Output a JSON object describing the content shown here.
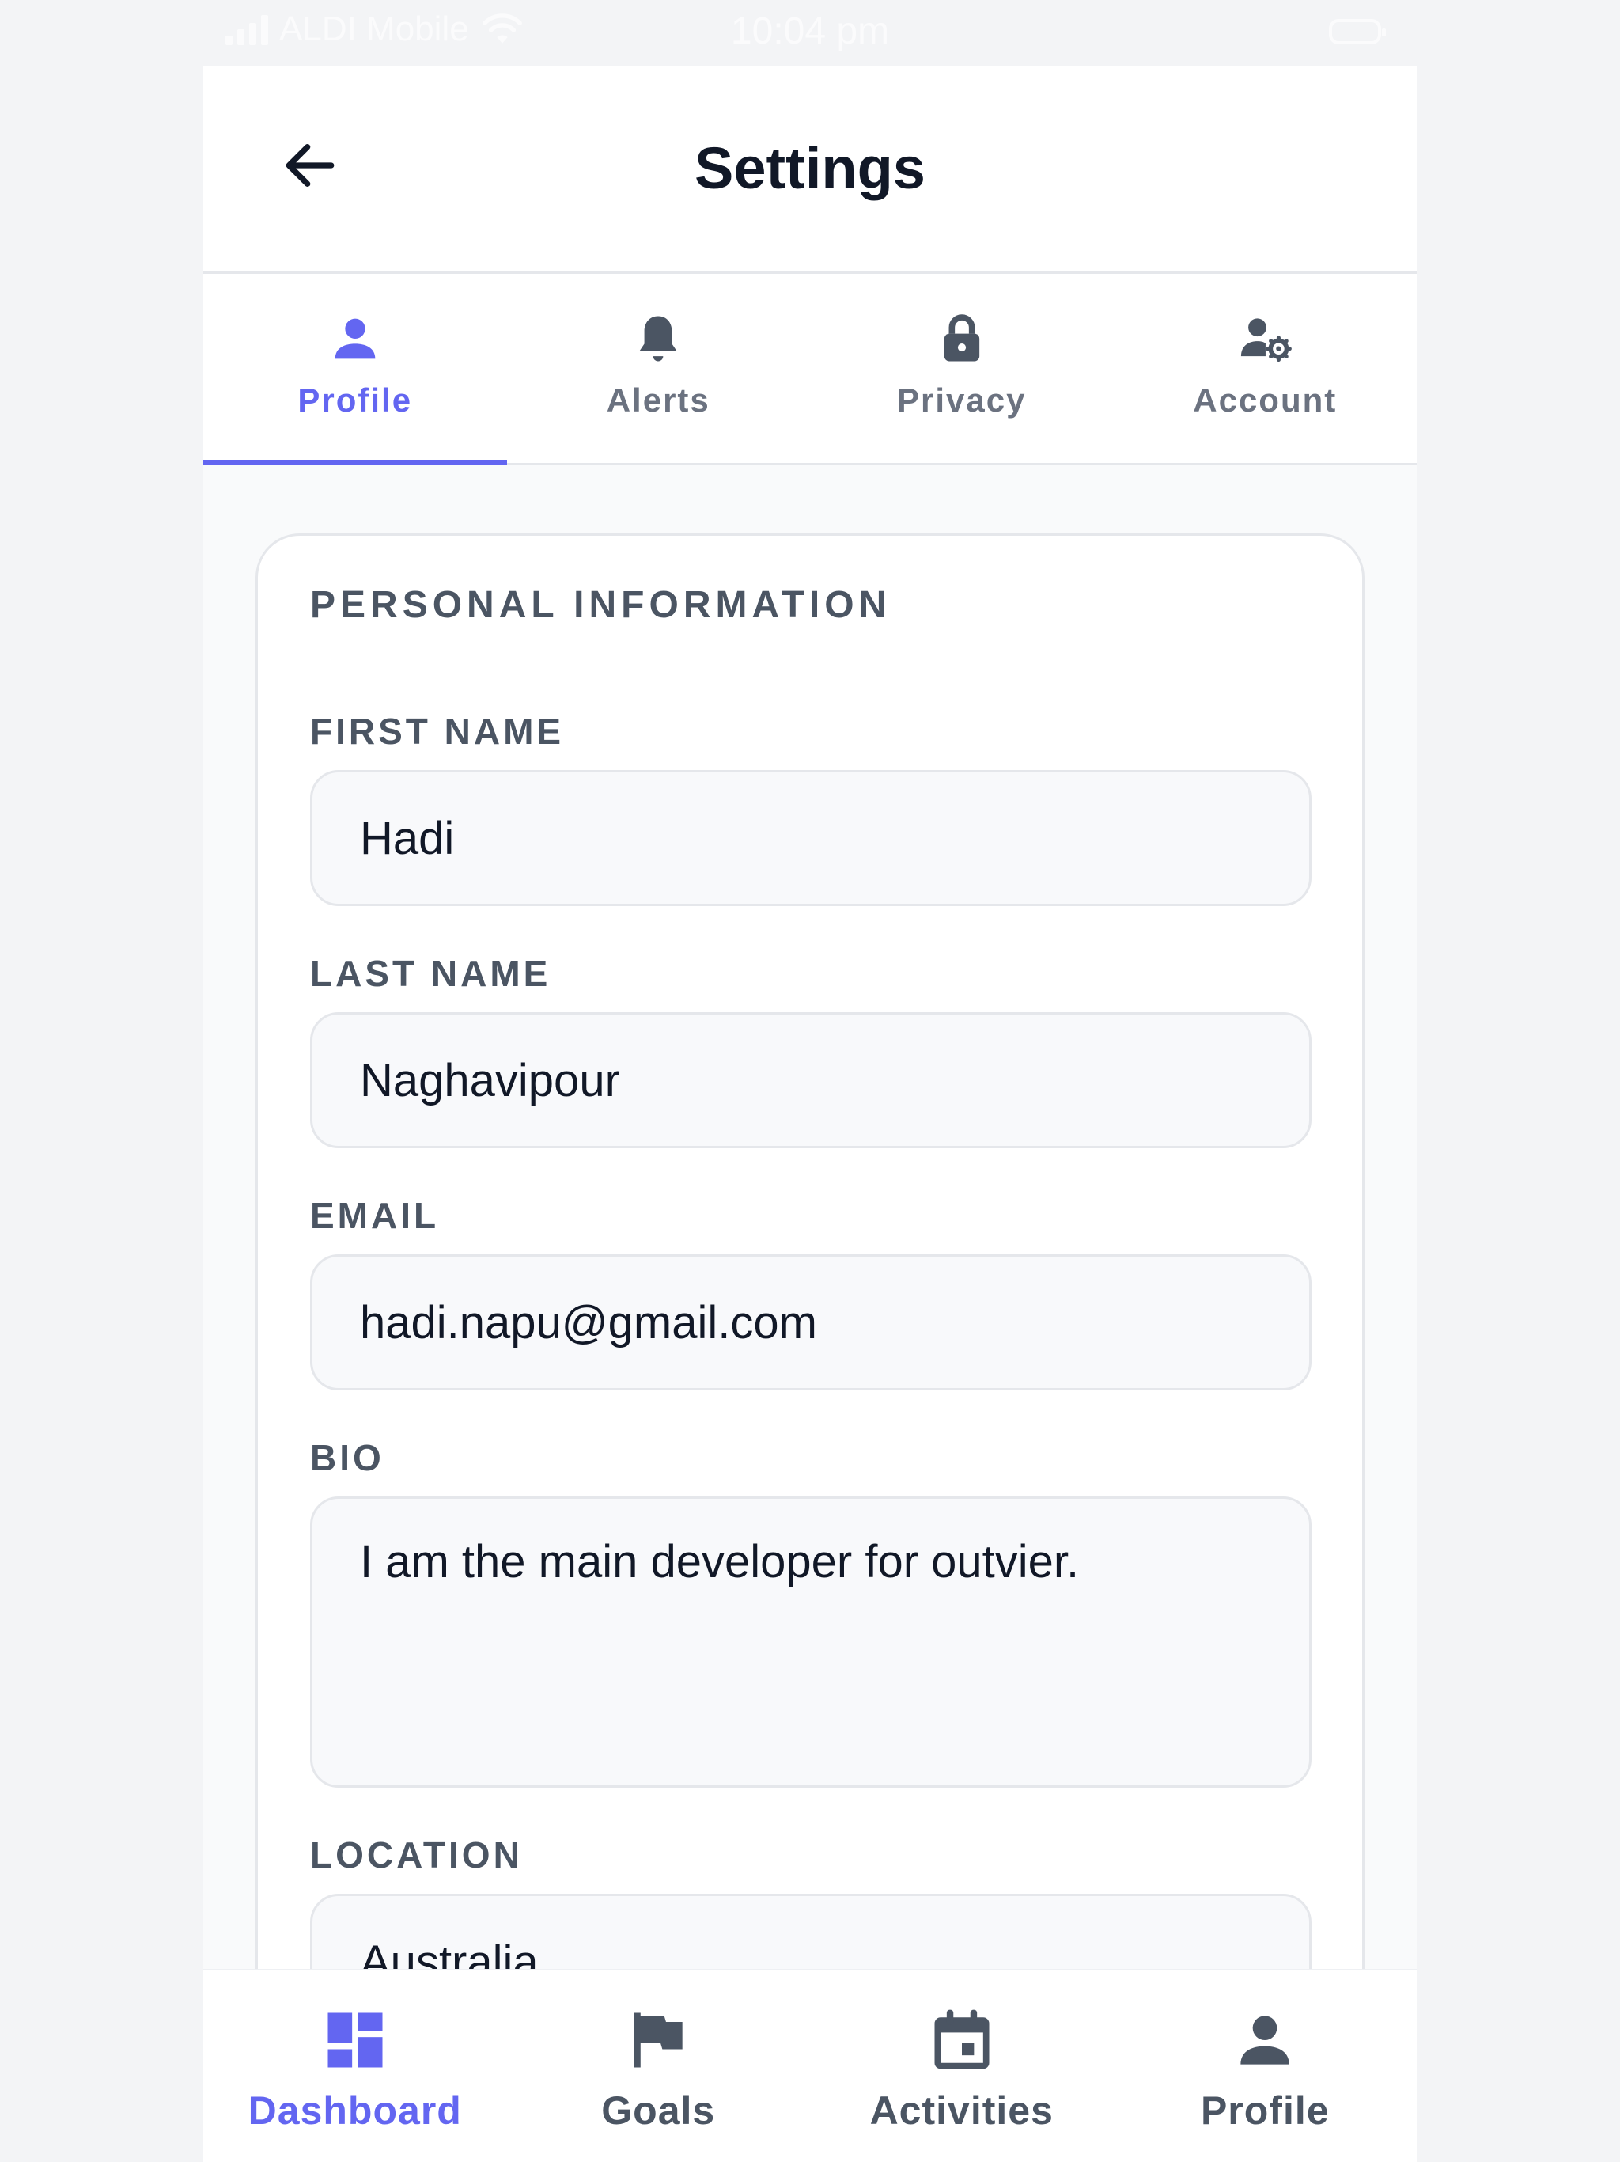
{
  "status_bar": {
    "carrier": "ALDI Mobile",
    "time": "10:04 pm"
  },
  "header": {
    "title": "Settings",
    "back_icon": "arrow-left-icon"
  },
  "tabs": [
    {
      "label": "Profile",
      "icon": "user-icon",
      "active": true
    },
    {
      "label": "Alerts",
      "icon": "bell-icon",
      "active": false
    },
    {
      "label": "Privacy",
      "icon": "lock-icon",
      "active": false
    },
    {
      "label": "Account",
      "icon": "user-gear-icon",
      "active": false
    }
  ],
  "card": {
    "section_title": "PERSONAL INFORMATION",
    "fields": {
      "first_name": {
        "label": "FIRST NAME",
        "value": "Hadi"
      },
      "last_name": {
        "label": "LAST NAME",
        "value": "Naghavipour"
      },
      "email": {
        "label": "EMAIL",
        "value": "hadi.napu@gmail.com"
      },
      "bio": {
        "label": "BIO",
        "value": "I am the main developer for outvier."
      },
      "location": {
        "label": "LOCATION",
        "value": "Australia"
      }
    }
  },
  "bottom_nav": [
    {
      "label": "Dashboard",
      "icon": "dashboard-icon",
      "active": true
    },
    {
      "label": "Goals",
      "icon": "flag-icon",
      "active": false
    },
    {
      "label": "Activities",
      "icon": "calendar-icon",
      "active": false
    },
    {
      "label": "Profile",
      "icon": "user-icon",
      "active": false
    }
  ],
  "colors": {
    "accent": "#6366f1",
    "text_primary": "#111827",
    "text_secondary": "#4b5563",
    "icon_inactive": "#4b5563",
    "border": "#e5e7eb",
    "input_bg": "#f8f9fb"
  }
}
